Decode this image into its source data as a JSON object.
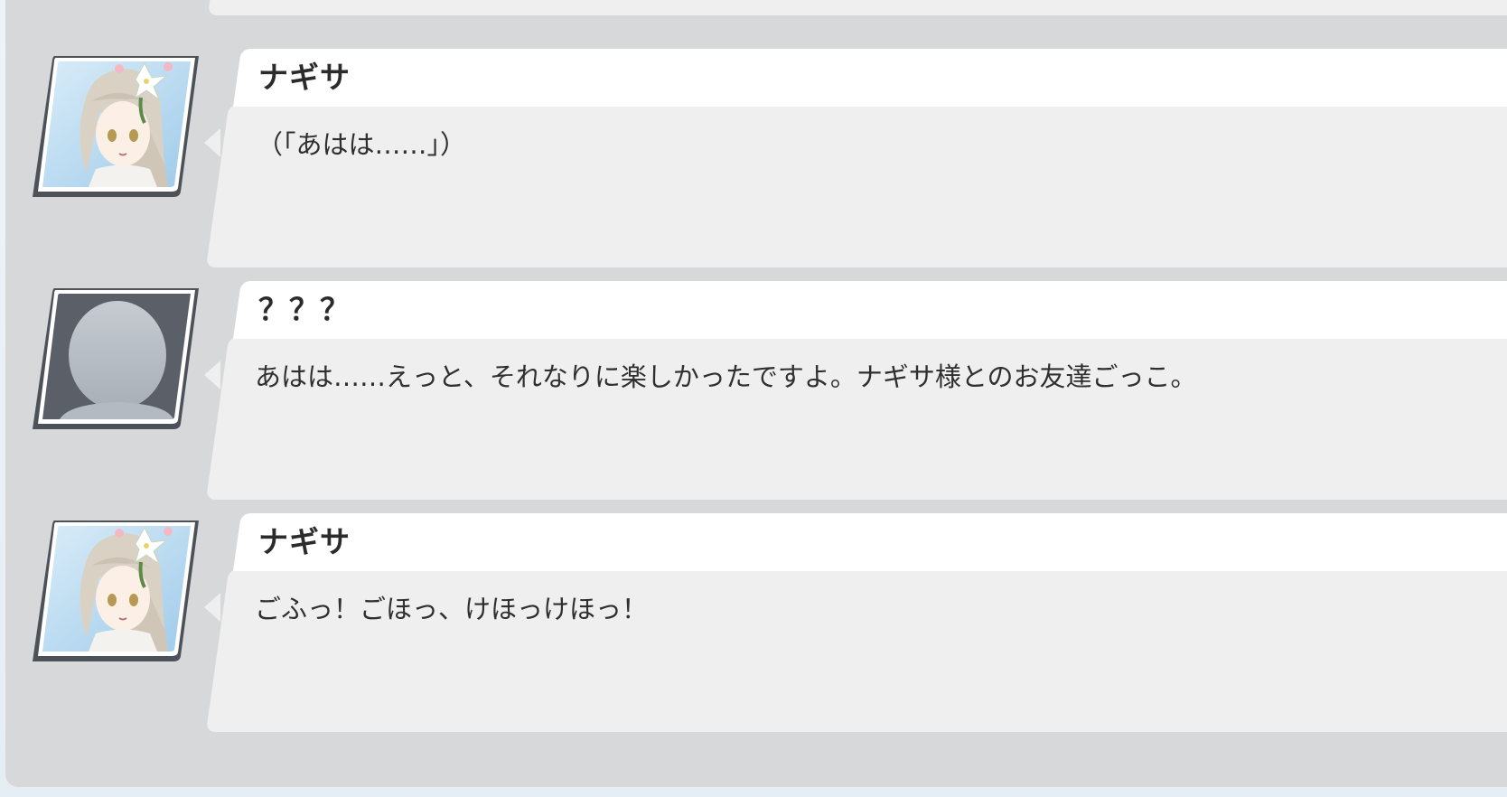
{
  "entries": [
    {
      "speaker": "ナギサ",
      "text": "（「あはは……」）",
      "portrait": "nagisa-portrait"
    },
    {
      "speaker": "？？？",
      "text": "あはは……えっと、それなりに楽しかったですよ。ナギサ様とのお友達ごっこ。",
      "portrait": "unknown-silhouette"
    },
    {
      "speaker": "ナギサ",
      "text": "ごふっ！ごほっ、けほっけほっ！",
      "portrait": "nagisa-portrait"
    }
  ],
  "colors": {
    "panel_bg": "#d7d8da",
    "name_bar": "#ffffff",
    "dialog_box": "#efefef",
    "silhouette_bg": "#5b6068"
  }
}
